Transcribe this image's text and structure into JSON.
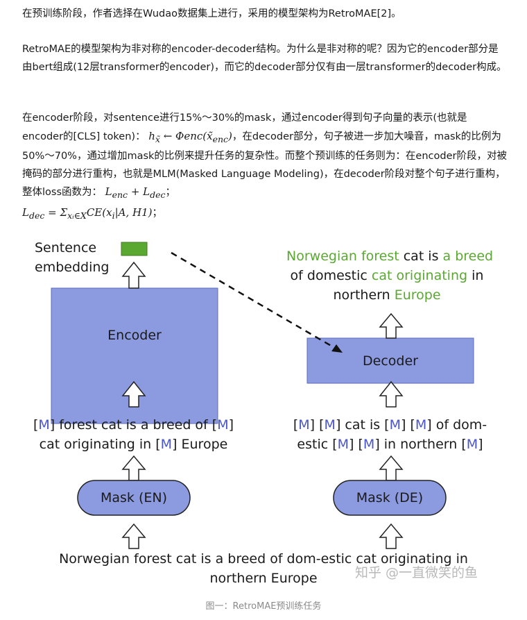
{
  "paragraphs": {
    "p1": "在预训练阶段，作者选择在Wudao数据集上进行，采用的模型架构为RetroMAE[2]。",
    "p2": "RetroMAE的模型架构为非对称的encoder-decoder结构。为什么是非对称的呢？因为它的encoder部分是由bert组成(12层transformer的encoder)，而它的decoder部分仅有由一层transformer的decoder构成。",
    "p3a": "在encoder阶段，对sentence进行15%～30%的mask，通过encoder得到句子向量的表示(也就是encoder的[CLS] token)：",
    "p3_math1": "h",
    "p3_math1_sub": "x̃",
    "p3_math1b": " ← Φenc(x̃",
    "p3_math1b_sub": "enc",
    "p3_math1c": ")",
    "p3b": "，在decoder部分，句子被进一步加大噪音，mask的比例为50%～70%，通过增加mask的比例来提升任务的复杂性。而整个预训练的任务则为：在encoder阶段，对被掩码的部分进行重构，也就是MLM(Masked Language Modeling)，在decoder阶段对整个句子进行重构，整体loss函数为：",
    "p3_math2a": "L",
    "p3_math2a_sub": "enc",
    "p3_math2b": " + L",
    "p3_math2b_sub": "dec",
    "p3c": "；",
    "p3_math3a": "L",
    "p3_math3a_sub": "dec",
    "p3_math3b": " = Σ",
    "p3_math3b_sub": "xᵢ∈X",
    "p3_math3c": "CE(x",
    "p3_math3c_sub": "i",
    "p3_math3d": "|A, H1)",
    "p3d": "；"
  },
  "figure": {
    "sentence_embedding_label_1": "Sentence",
    "sentence_embedding_label_2": "embedding",
    "encoder_label": "Encoder",
    "decoder_label": "Decoder",
    "decoder_output": {
      "l1a": "Norwegian forest",
      "l1b": " cat is ",
      "l1c": "a breed",
      "l2a": "of domestic ",
      "l2b": "cat originating",
      "l2c": " in",
      "l3a": "northern ",
      "l3b": "Europe"
    },
    "encoder_input": {
      "l1a": "[",
      "l1m1": "M",
      "l1b": "] forest cat is a breed of [",
      "l1m2": "M",
      "l1c": "]",
      "l2a": "cat originating in [",
      "l2m": "M",
      "l2b": "] Europe"
    },
    "decoder_input": {
      "l1a": "[",
      "l1m1": "M",
      "l1b": "] [",
      "l1m2": "M",
      "l1c": "] cat is [",
      "l1m3": "M",
      "l1d": "] [",
      "l1m4": "M",
      "l1e": "] of dom-",
      "l2a": "estic [",
      "l2m1": "M",
      "l2b": "] [",
      "l2m2": "M",
      "l2c": "] in northern [",
      "l2m3": "M",
      "l2d": "]"
    },
    "mask_en_label": "Mask (EN)",
    "mask_de_label": "Mask (DE)",
    "source_sentence_1": "Norwegian forest cat is a breed of dom-estic cat originating in",
    "source_sentence_2": "northern Europe",
    "watermark": "知乎 @一直微笑的鱼"
  },
  "caption": "图一：RetroMAE预训练任务",
  "colors": {
    "block_fill": "#8c9ae0",
    "green": "#5aa832",
    "mask_blue": "#4a55c7"
  }
}
